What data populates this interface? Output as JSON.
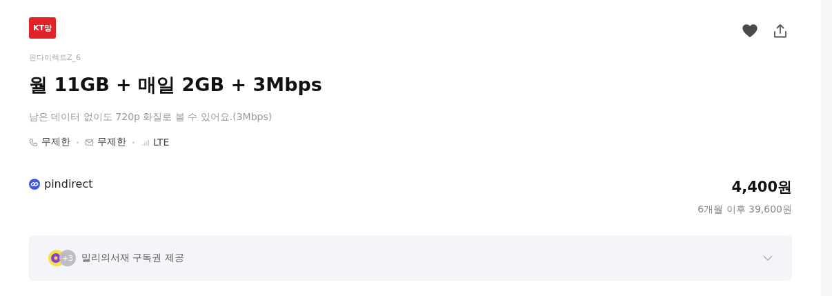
{
  "badge": "KT망",
  "provider": "핀다이렉트Z_6",
  "title": "월 11GB + 매일 2GB + 3Mbps",
  "description": "남은 데이터 없이도 720p 화질로 볼 수 있어요.(3Mbps)",
  "features": [
    {
      "kind": "call",
      "label": "무제한"
    },
    {
      "kind": "message",
      "label": "무제한"
    },
    {
      "kind": "network",
      "label": "LTE"
    }
  ],
  "favorite": true,
  "seller": "pindirect",
  "price": "4,400원",
  "price_after": "6개월 이후 39,600원",
  "benefit": {
    "extra_count": "+3",
    "label": "밀리의서재 구독권 제공",
    "expanded": false
  }
}
